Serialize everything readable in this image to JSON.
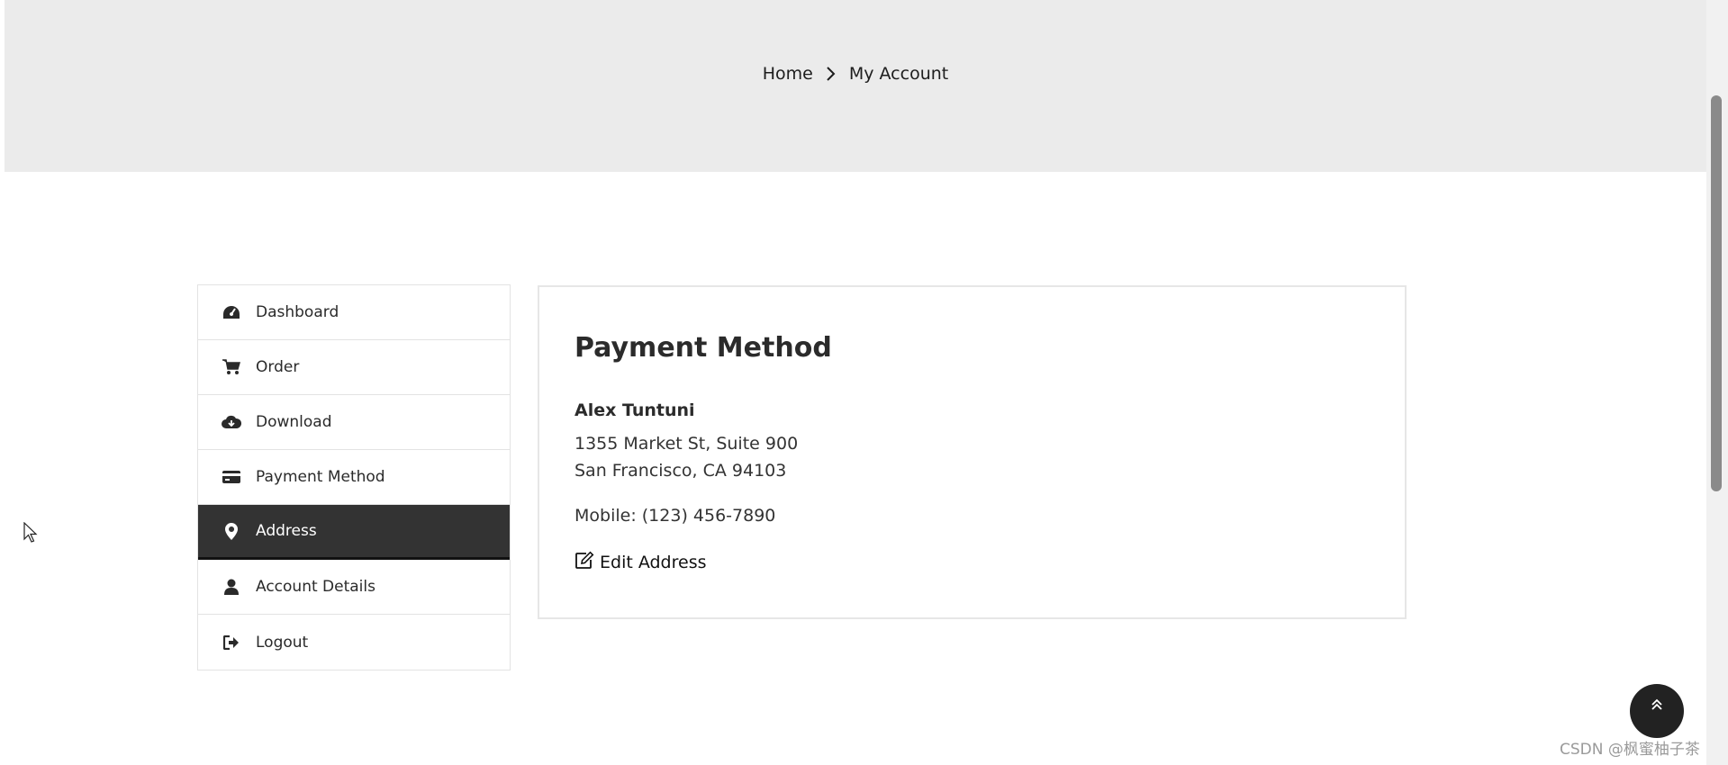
{
  "breadcrumb": {
    "home": "Home",
    "current": "My Account"
  },
  "sidebar": {
    "items": [
      {
        "label": "Dashboard",
        "icon": "dashboard-icon",
        "active": false
      },
      {
        "label": "Order",
        "icon": "cart-icon",
        "active": false
      },
      {
        "label": "Download",
        "icon": "cloud-download-icon",
        "active": false
      },
      {
        "label": "Payment Method",
        "icon": "credit-card-icon",
        "active": false
      },
      {
        "label": "Address",
        "icon": "map-marker-icon",
        "active": true
      },
      {
        "label": "Account Details",
        "icon": "user-icon",
        "active": false
      },
      {
        "label": "Logout",
        "icon": "sign-out-icon",
        "active": false
      }
    ]
  },
  "content": {
    "title": "Payment Method",
    "name": "Alex Tuntuni",
    "address_line1": "1355 Market St, Suite 900",
    "address_line2": "San Francisco, CA 94103",
    "mobile": "Mobile: (123) 456-7890",
    "edit_label": "Edit Address"
  },
  "watermark": "CSDN @枫蜜柚子茶",
  "colors": {
    "hero_bg": "#ebebeb",
    "active_bg": "#333333",
    "border": "#e3e3e3"
  }
}
